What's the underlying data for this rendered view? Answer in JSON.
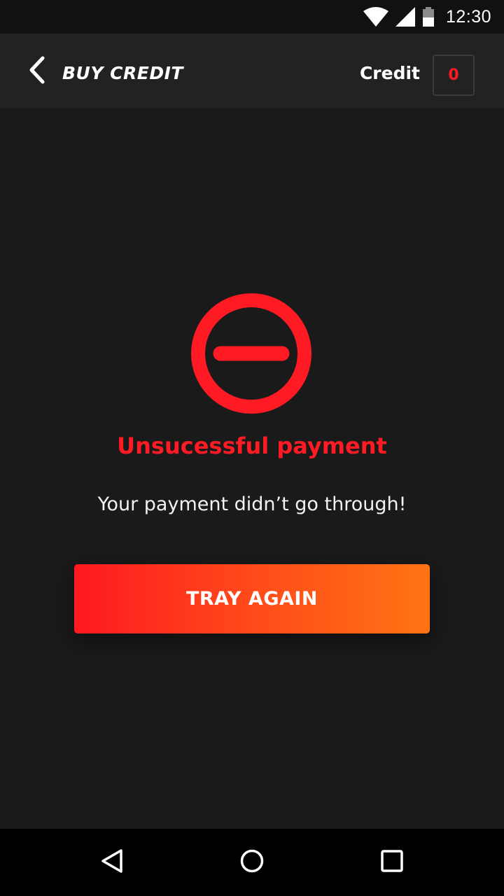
{
  "status_bar": {
    "time": "12:30",
    "icons": [
      "wifi-icon",
      "cell-signal-icon",
      "battery-icon"
    ]
  },
  "app_bar": {
    "back_icon": "chevron-left-icon",
    "title": "BUY CREDIT",
    "credit_label": "Credit",
    "credit_value": "0"
  },
  "result": {
    "icon": "no-entry-icon",
    "title": "Unsucessful payment",
    "message": "Your payment didn’t go through!",
    "retry_label": "TRAY AGAIN"
  },
  "nav_bar": {
    "icons": [
      "back-triangle-icon",
      "home-circle-icon",
      "recents-square-icon"
    ]
  },
  "colors": {
    "accent_red": "#ff1a24",
    "button_gradient_start": "#ff1920",
    "button_gradient_end": "#ff7414",
    "background": "#1a1a1a",
    "app_bar": "#222222"
  }
}
